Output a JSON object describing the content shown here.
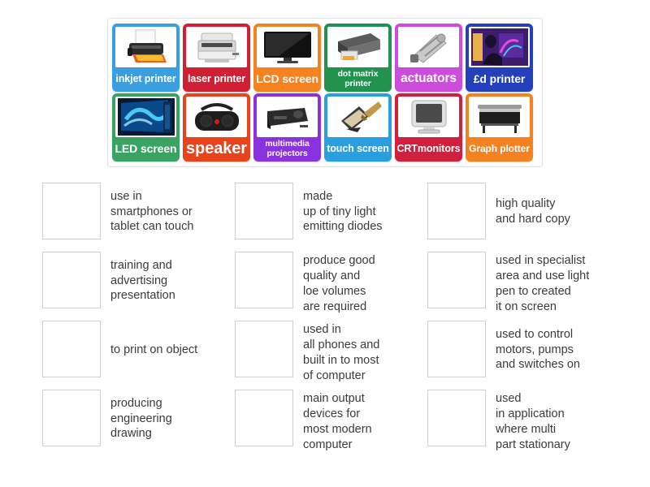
{
  "tile_bank": {
    "name": "draggable-tile-bank",
    "rows": [
      [
        {
          "label": "inkjet printer",
          "color": "#3a9fe0",
          "icon": "inkjet-printer-icon",
          "size": "fs-13"
        },
        {
          "label": "laser printer",
          "color": "#d11f33",
          "icon": "laser-printer-icon",
          "size": "fs-13"
        },
        {
          "label": "LCD screen",
          "color": "#f58220",
          "icon": "lcd-screen-icon",
          "size": "fs-14"
        },
        {
          "label": "dot matrix\nprinter",
          "color": "#22934f",
          "icon": "dot-matrix-printer-icon",
          "size": "fs-10"
        },
        {
          "label": "actuators",
          "color": "#cc4ddb",
          "icon": "actuator-icon",
          "size": "fs-15"
        },
        {
          "label": "£d printer",
          "color": "#2440bb",
          "icon": "3d-printer-icon",
          "size": "fs-14"
        }
      ],
      [
        {
          "label": "LED screen",
          "color": "#3aa364",
          "icon": "led-screen-icon",
          "size": "fs-14"
        },
        {
          "label": "speaker",
          "color": "#e8431a",
          "icon": "speaker-icon",
          "size": "fs-19"
        },
        {
          "label": "multimedia\nprojectors",
          "color": "#8833dd",
          "icon": "projector-icon",
          "size": "fs-10"
        },
        {
          "label": "touch screen",
          "color": "#2a9fe0",
          "icon": "touch-screen-icon",
          "size": "fs-13"
        },
        {
          "label": "CRTmonitors",
          "color": "#d11f3e",
          "icon": "crt-monitor-icon",
          "size": "fs-13"
        },
        {
          "label": "Graph plotter",
          "color": "#f58220",
          "icon": "graph-plotter-icon",
          "size": "fs-12"
        }
      ]
    ]
  },
  "answers": [
    {
      "text": "use in\nsmartphones or\ntablet can touch"
    },
    {
      "text": "made\nup of tiny light\nemitting diodes"
    },
    {
      "text": "high quality\nand hard copy"
    },
    {
      "text": "training and\nadvertising\npresentation"
    },
    {
      "text": "produce good\nquality and\nloe volumes\nare required"
    },
    {
      "text": "used in specialist\narea and use light\npen to created\nit on screen"
    },
    {
      "text": "to print on object"
    },
    {
      "text": "used in\nall phones and\nbuilt in to most\nof computer"
    },
    {
      "text": "used to control\nmotors, pumps\nand switches on"
    },
    {
      "text": "producing\nengineering\ndrawing"
    },
    {
      "text": "main output\ndevices for\nmost modern\ncomputer"
    },
    {
      "text": "used\nin application\nwhere multi\npart stationary"
    }
  ]
}
